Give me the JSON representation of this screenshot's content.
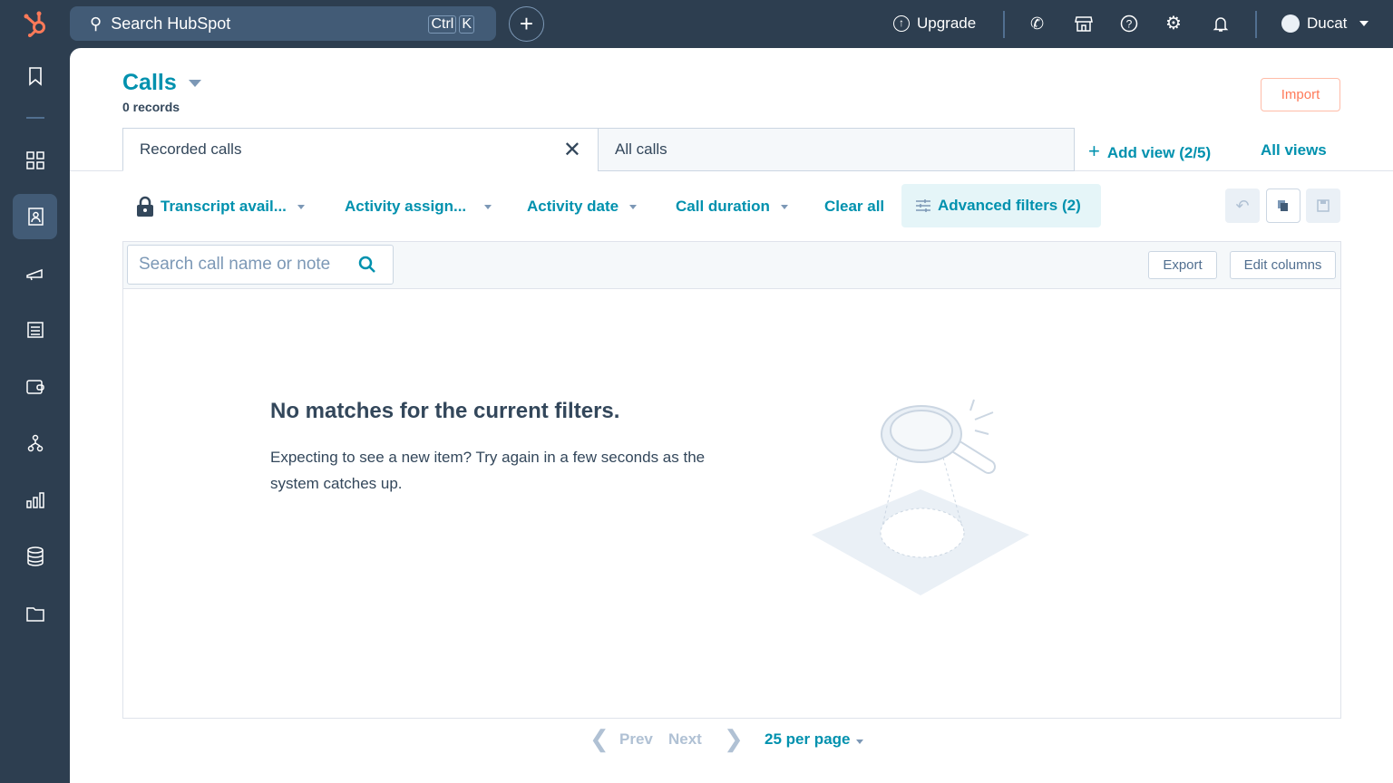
{
  "topbar": {
    "search_placeholder": "Search HubSpot",
    "kbd_ctrl": "Ctrl",
    "kbd_k": "K",
    "upgrade": "Upgrade",
    "user": "Ducat"
  },
  "sidebar": {
    "items": [
      "bookmarks",
      "dashboards",
      "contacts",
      "marketing",
      "content",
      "commerce",
      "automation",
      "reporting",
      "data-management",
      "library"
    ],
    "active": "contacts"
  },
  "page": {
    "title": "Calls",
    "records": "0 records",
    "import": "Import"
  },
  "views": {
    "tabs": [
      {
        "label": "Recorded calls",
        "active": true
      },
      {
        "label": "All calls",
        "active": false
      }
    ],
    "add_view": "Add view (2/5)",
    "all_views": "All views"
  },
  "filters": {
    "items": [
      "Transcript avail...",
      "Activity assign...",
      "Activity date",
      "Call duration"
    ],
    "clear_all": "Clear all",
    "advanced": "Advanced filters (2)"
  },
  "table": {
    "search_placeholder": "Search call name or note",
    "export": "Export",
    "edit_columns": "Edit columns"
  },
  "empty": {
    "heading": "No matches for the current filters.",
    "body": "Expecting to see a new item? Try again in a few seconds as the system catches up."
  },
  "pagination": {
    "prev": "Prev",
    "next": "Next",
    "per_page": "25 per page"
  },
  "colors": {
    "accent": "#0091ae",
    "nav": "#2d3e50",
    "orange": "#ff7a59"
  }
}
